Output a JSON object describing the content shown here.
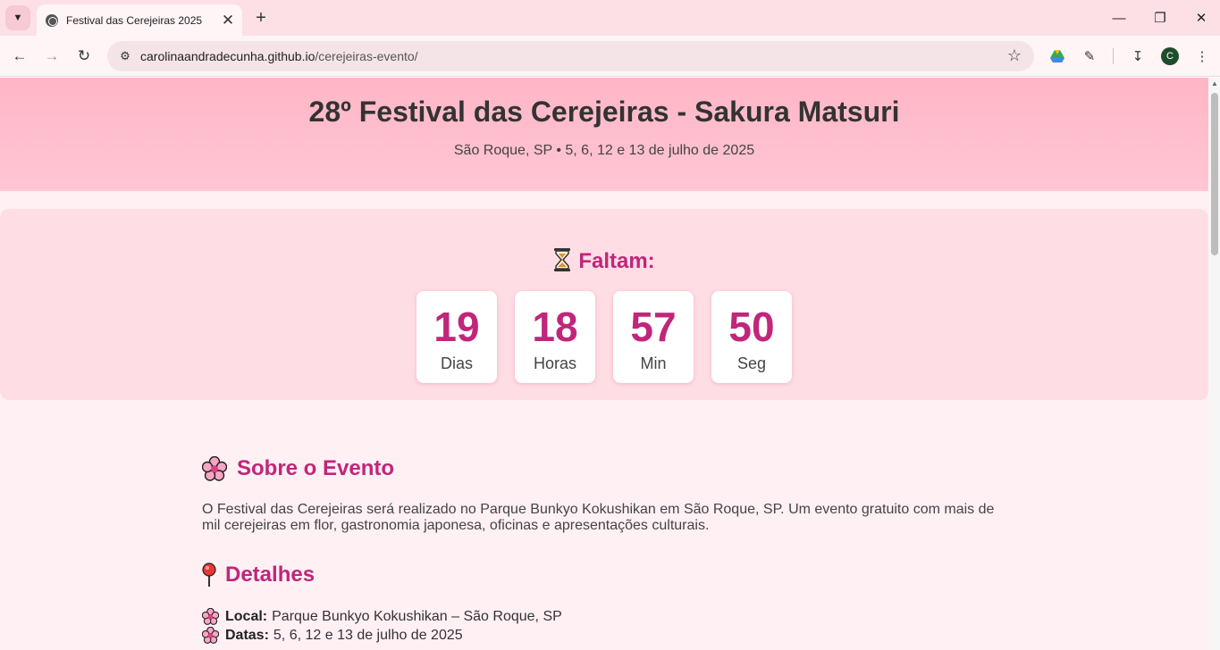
{
  "browser": {
    "tab_title": "Festival das Cerejeiras 2025",
    "url_domain": "carolinaandradecunha.github.io",
    "url_path": "/cerejeiras-evento/",
    "profile_initial": "C"
  },
  "hero": {
    "title": "28º Festival das Cerejeiras - Sakura Matsuri",
    "subtitle": "São Roque, SP • 5, 6, 12 e 13 de julho de 2025"
  },
  "countdown": {
    "title": "Faltam:",
    "units": [
      {
        "value": "19",
        "label": "Dias"
      },
      {
        "value": "18",
        "label": "Horas"
      },
      {
        "value": "57",
        "label": "Min"
      },
      {
        "value": "50",
        "label": "Seg"
      }
    ]
  },
  "about": {
    "heading": "Sobre o Evento",
    "text": "O Festival das Cerejeiras será realizado no Parque Bunkyo Kokushikan em São Roque, SP. Um evento gratuito com mais de mil cerejeiras em flor, gastronomia japonesa, oficinas e apresentações culturais."
  },
  "details": {
    "heading": "Detalhes",
    "items": [
      {
        "label": "Local:",
        "value": "Parque Bunkyo Kokushikan – São Roque, SP"
      },
      {
        "label": "Datas:",
        "value": "5, 6, 12 e 13 de julho de 2025"
      }
    ]
  },
  "colors": {
    "accent": "#c0267a",
    "hero_bg": "#ffb6c7",
    "panel_bg": "#ffdde5",
    "page_bg": "#fff0f4"
  },
  "icons": [
    "chevron-down-icon",
    "globe-icon",
    "close-icon",
    "plus-icon",
    "back-icon",
    "forward-icon",
    "reload-icon",
    "site-info-icon",
    "star-icon",
    "drive-icon",
    "extensions-icon",
    "download-icon",
    "menu-icon",
    "hourglass-icon",
    "cherry-blossom-icon",
    "pushpin-icon"
  ]
}
